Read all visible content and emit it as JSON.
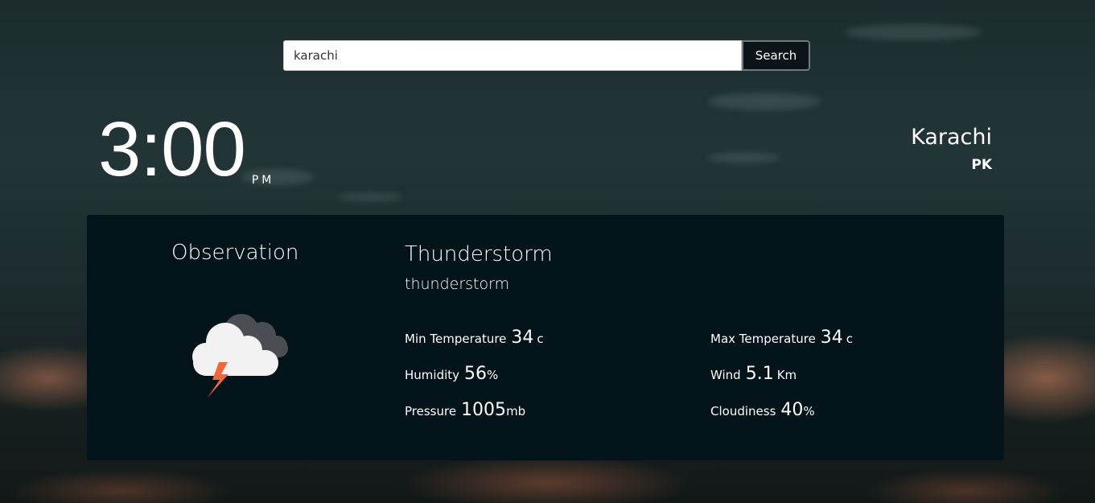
{
  "search": {
    "value": "karachi",
    "button_label": "Search"
  },
  "time": {
    "value": "3:00",
    "period": "PM"
  },
  "location": {
    "city": "Karachi",
    "country": "PK"
  },
  "observation": {
    "heading": "Observation",
    "icon": "thunderstorm-cloud-icon",
    "condition_main": "Thunderstorm",
    "condition_description": "thunderstorm",
    "stats": {
      "min_temp": {
        "label": "Min Temperature",
        "value": "34",
        "unit": "c"
      },
      "max_temp": {
        "label": "Max Temperature",
        "value": "34",
        "unit": "c"
      },
      "humidity": {
        "label": "Humidity",
        "value": "56",
        "unit": "%"
      },
      "wind": {
        "label": "Wind",
        "value": "5.1",
        "unit": "Km"
      },
      "pressure": {
        "label": "Pressure",
        "value": "1005",
        "unit": "mb"
      },
      "cloudiness": {
        "label": "Cloudiness",
        "value": "40",
        "unit": "%"
      }
    }
  },
  "colors": {
    "panel_bg": "#03131a",
    "button_bg": "#0b1418",
    "lightning": "#f0683a"
  }
}
